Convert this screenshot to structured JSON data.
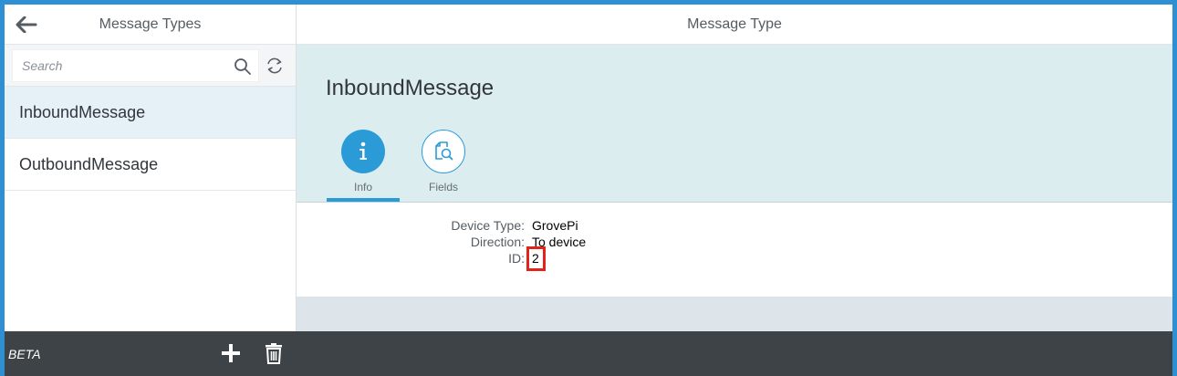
{
  "master": {
    "title": "Message Types",
    "search_placeholder": "Search",
    "items": [
      {
        "label": "InboundMessage",
        "selected": true
      },
      {
        "label": "OutboundMessage",
        "selected": false
      }
    ]
  },
  "detail": {
    "title": "Message Type",
    "object_title": "InboundMessage",
    "tabs": [
      {
        "label": "Info",
        "icon": "info-icon",
        "active": true
      },
      {
        "label": "Fields",
        "icon": "document-search-icon",
        "active": false
      }
    ],
    "fields": [
      {
        "label": "Device Type:",
        "value": "GrovePi"
      },
      {
        "label": "Direction:",
        "value": "To device"
      },
      {
        "label": "ID:",
        "value": "2"
      }
    ]
  },
  "footer": {
    "beta_label": "BETA"
  },
  "colors": {
    "accent": "#2b9bd8",
    "header_bg": "#dcedf0",
    "footer_bg": "#3d4347",
    "highlight": "#e2231a"
  }
}
